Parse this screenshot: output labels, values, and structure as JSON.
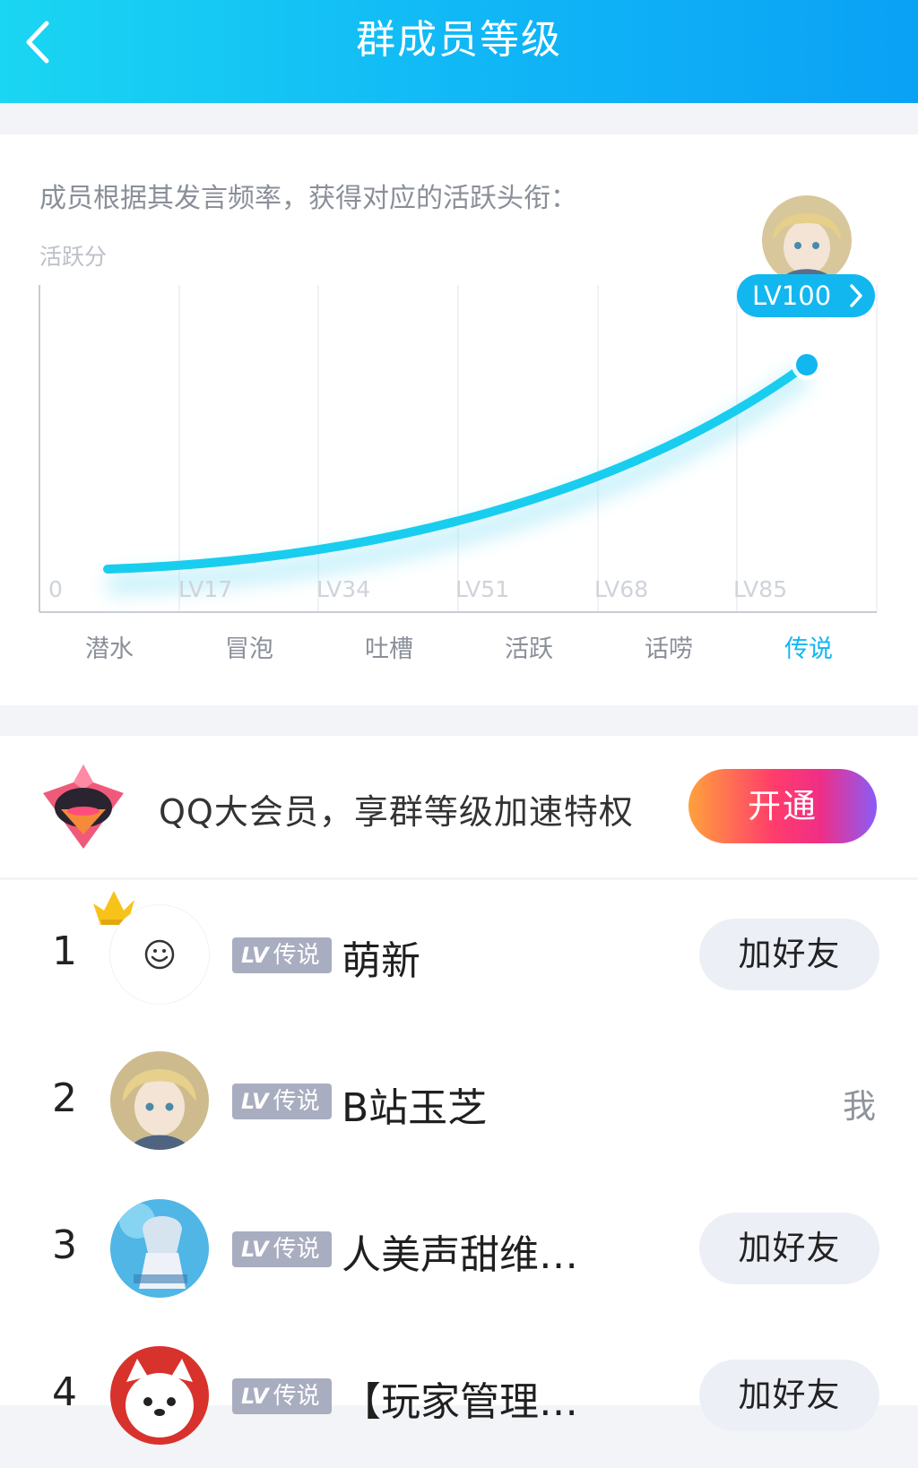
{
  "header": {
    "title": "群成员等级"
  },
  "chart": {
    "intro": "成员根据其发言频率，获得对应的活跃头衔：",
    "y_label": "活跃分",
    "stages": [
      "潜水",
      "冒泡",
      "吐槽",
      "活跃",
      "话唠",
      "传说"
    ],
    "active_stage": "传说",
    "level_ticks": [
      "0",
      "LV17",
      "LV34",
      "LV51",
      "LV68",
      "LV85"
    ],
    "peak_badge": "LV100"
  },
  "chart_data": {
    "type": "line",
    "categories": [
      "潜水",
      "冒泡",
      "吐槽",
      "活跃",
      "话唠",
      "传说"
    ],
    "level_ticks": [
      "0",
      "LV17",
      "LV34",
      "LV51",
      "LV68",
      "LV85"
    ],
    "ylabel": "活跃分",
    "curve": "exponential-growth",
    "end_label": "LV100",
    "grid": true,
    "accent_color": "#12b7f0"
  },
  "promo": {
    "text": "QQ大会员，享群等级加速特权",
    "button_label": "开通",
    "icon": "vip-diamond-icon"
  },
  "members": [
    {
      "rank": "1",
      "badge_prefix": "LV",
      "badge": "传说",
      "name": "萌新",
      "action": "加好友",
      "crown": true
    },
    {
      "rank": "2",
      "badge_prefix": "LV",
      "badge": "传说",
      "name": "B站玉芝",
      "action": "我"
    },
    {
      "rank": "3",
      "badge_prefix": "LV",
      "badge": "传说",
      "name": "人美声甜维…",
      "action": "加好友"
    },
    {
      "rank": "4",
      "badge_prefix": "LV",
      "badge": "传说",
      "name": "【玩家管理…",
      "action": "加好友"
    }
  ],
  "colors": {
    "header_gradient": [
      "#1ad6f2",
      "#0aa1f5"
    ],
    "accent": "#12b7f0",
    "badge_bg": "#a9adc0",
    "button_bg": "#eceff5",
    "promo_gradient": [
      "#ffa13d",
      "#ff3d6b",
      "#8a5cf7"
    ]
  }
}
